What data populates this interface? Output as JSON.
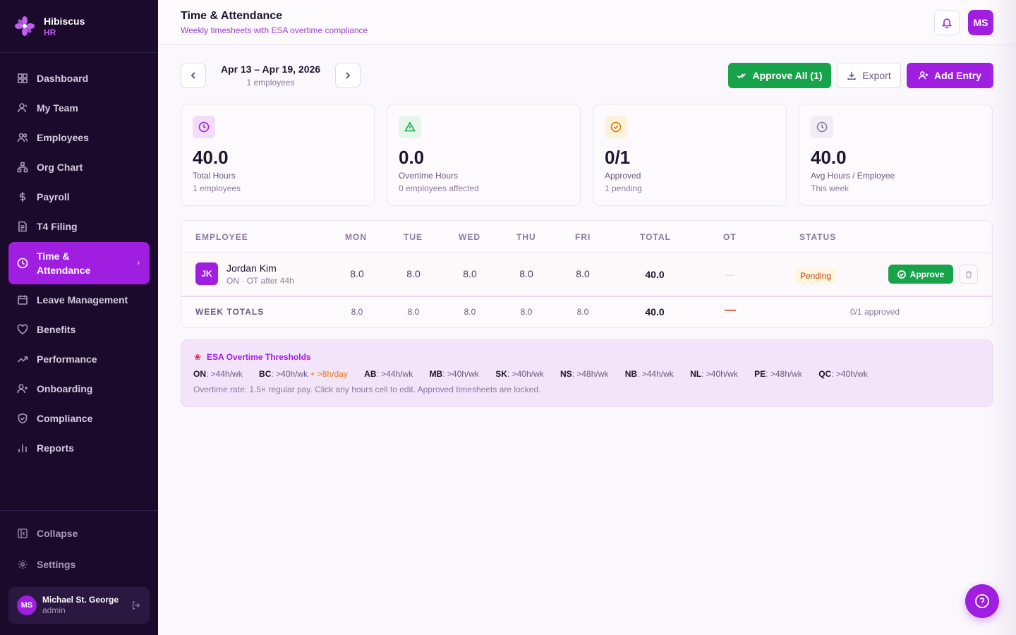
{
  "brand": {
    "name": "Hibiscus",
    "sub": "HR"
  },
  "nav": {
    "items": [
      {
        "label": "Dashboard",
        "icon": "grid-icon"
      },
      {
        "label": "My Team",
        "icon": "user-icon"
      },
      {
        "label": "Employees",
        "icon": "users-icon"
      },
      {
        "label": "Org Chart",
        "icon": "org-chart-icon"
      },
      {
        "label": "Payroll",
        "icon": "dollar-icon"
      },
      {
        "label": "T4 Filing",
        "icon": "document-icon"
      },
      {
        "label": "Time & Attendance",
        "icon": "clock-icon",
        "active": true
      },
      {
        "label": "Leave Management",
        "icon": "calendar-icon"
      },
      {
        "label": "Benefits",
        "icon": "heart-icon"
      },
      {
        "label": "Performance",
        "icon": "trending-icon"
      },
      {
        "label": "Onboarding",
        "icon": "user-plus-icon"
      },
      {
        "label": "Compliance",
        "icon": "shield-icon"
      },
      {
        "label": "Reports",
        "icon": "bar-chart-icon"
      }
    ],
    "collapse": "Collapse",
    "settings": "Settings"
  },
  "user": {
    "initials": "MS",
    "name": "Michael St. George",
    "role": "admin"
  },
  "header": {
    "title": "Time & Attendance",
    "subtitle": "Weekly timesheets with ESA overtime compliance",
    "avatar": "MS"
  },
  "week": {
    "range": "Apr 13 – Apr 19, 2026",
    "count": "1 employees"
  },
  "actions": {
    "approve_all": "Approve All (1)",
    "export": "Export",
    "add": "Add Entry"
  },
  "stats": [
    {
      "value": "40.0",
      "label": "Total Hours",
      "sub": "1 employees",
      "icon": "clock-icon",
      "color": "#a01ee0",
      "bg": "#f2dcfa"
    },
    {
      "value": "0.0",
      "label": "Overtime Hours",
      "sub": "0 employees affected",
      "icon": "alert-triangle-icon",
      "color": "#16a34a",
      "bg": "#e6f6ea"
    },
    {
      "value": "0/1",
      "label": "Approved",
      "sub": "1 pending",
      "icon": "check-circle-icon",
      "color": "#d97706",
      "bg": "#fdf3dc"
    },
    {
      "value": "40.0",
      "label": "Avg Hours / Employee",
      "sub": "This week",
      "icon": "clock-icon",
      "color": "#8a7a9c",
      "bg": "#f1ecf5"
    }
  ],
  "table": {
    "headers": [
      "EMPLOYEE",
      "MON",
      "TUE",
      "WED",
      "THU",
      "FRI",
      "TOTAL",
      "OT",
      "STATUS"
    ],
    "row": {
      "initials": "JK",
      "name": "Jordan Kim",
      "sub": "ON · OT after 44h",
      "days": [
        "8.0",
        "8.0",
        "8.0",
        "8.0",
        "8.0"
      ],
      "total": "40.0",
      "ot": "—",
      "status": "Pending",
      "approve": "Approve"
    },
    "totals": {
      "label": "WEEK TOTALS",
      "days": [
        "8.0",
        "8.0",
        "8.0",
        "8.0",
        "8.0"
      ],
      "total": "40.0",
      "ot": "—",
      "approved": "0/1 approved"
    }
  },
  "esa": {
    "title": "ESA Overtime Thresholds",
    "provinces": [
      {
        "code": "ON",
        "rule": ">44h/wk"
      },
      {
        "code": "BC",
        "rule": ">40h/wk",
        "extra": "+ >8h/day"
      },
      {
        "code": "AB",
        "rule": ">44h/wk"
      },
      {
        "code": "MB",
        "rule": ">40h/wk"
      },
      {
        "code": "SK",
        "rule": ">40h/wk"
      },
      {
        "code": "NS",
        "rule": ">48h/wk"
      },
      {
        "code": "NB",
        "rule": ">44h/wk"
      },
      {
        "code": "NL",
        "rule": ">40h/wk"
      },
      {
        "code": "PE",
        "rule": ">48h/wk"
      },
      {
        "code": "QC",
        "rule": ">40h/wk"
      }
    ],
    "note": "Overtime rate: 1.5× regular pay. Click any hours cell to edit. Approved timesheets are locked."
  }
}
